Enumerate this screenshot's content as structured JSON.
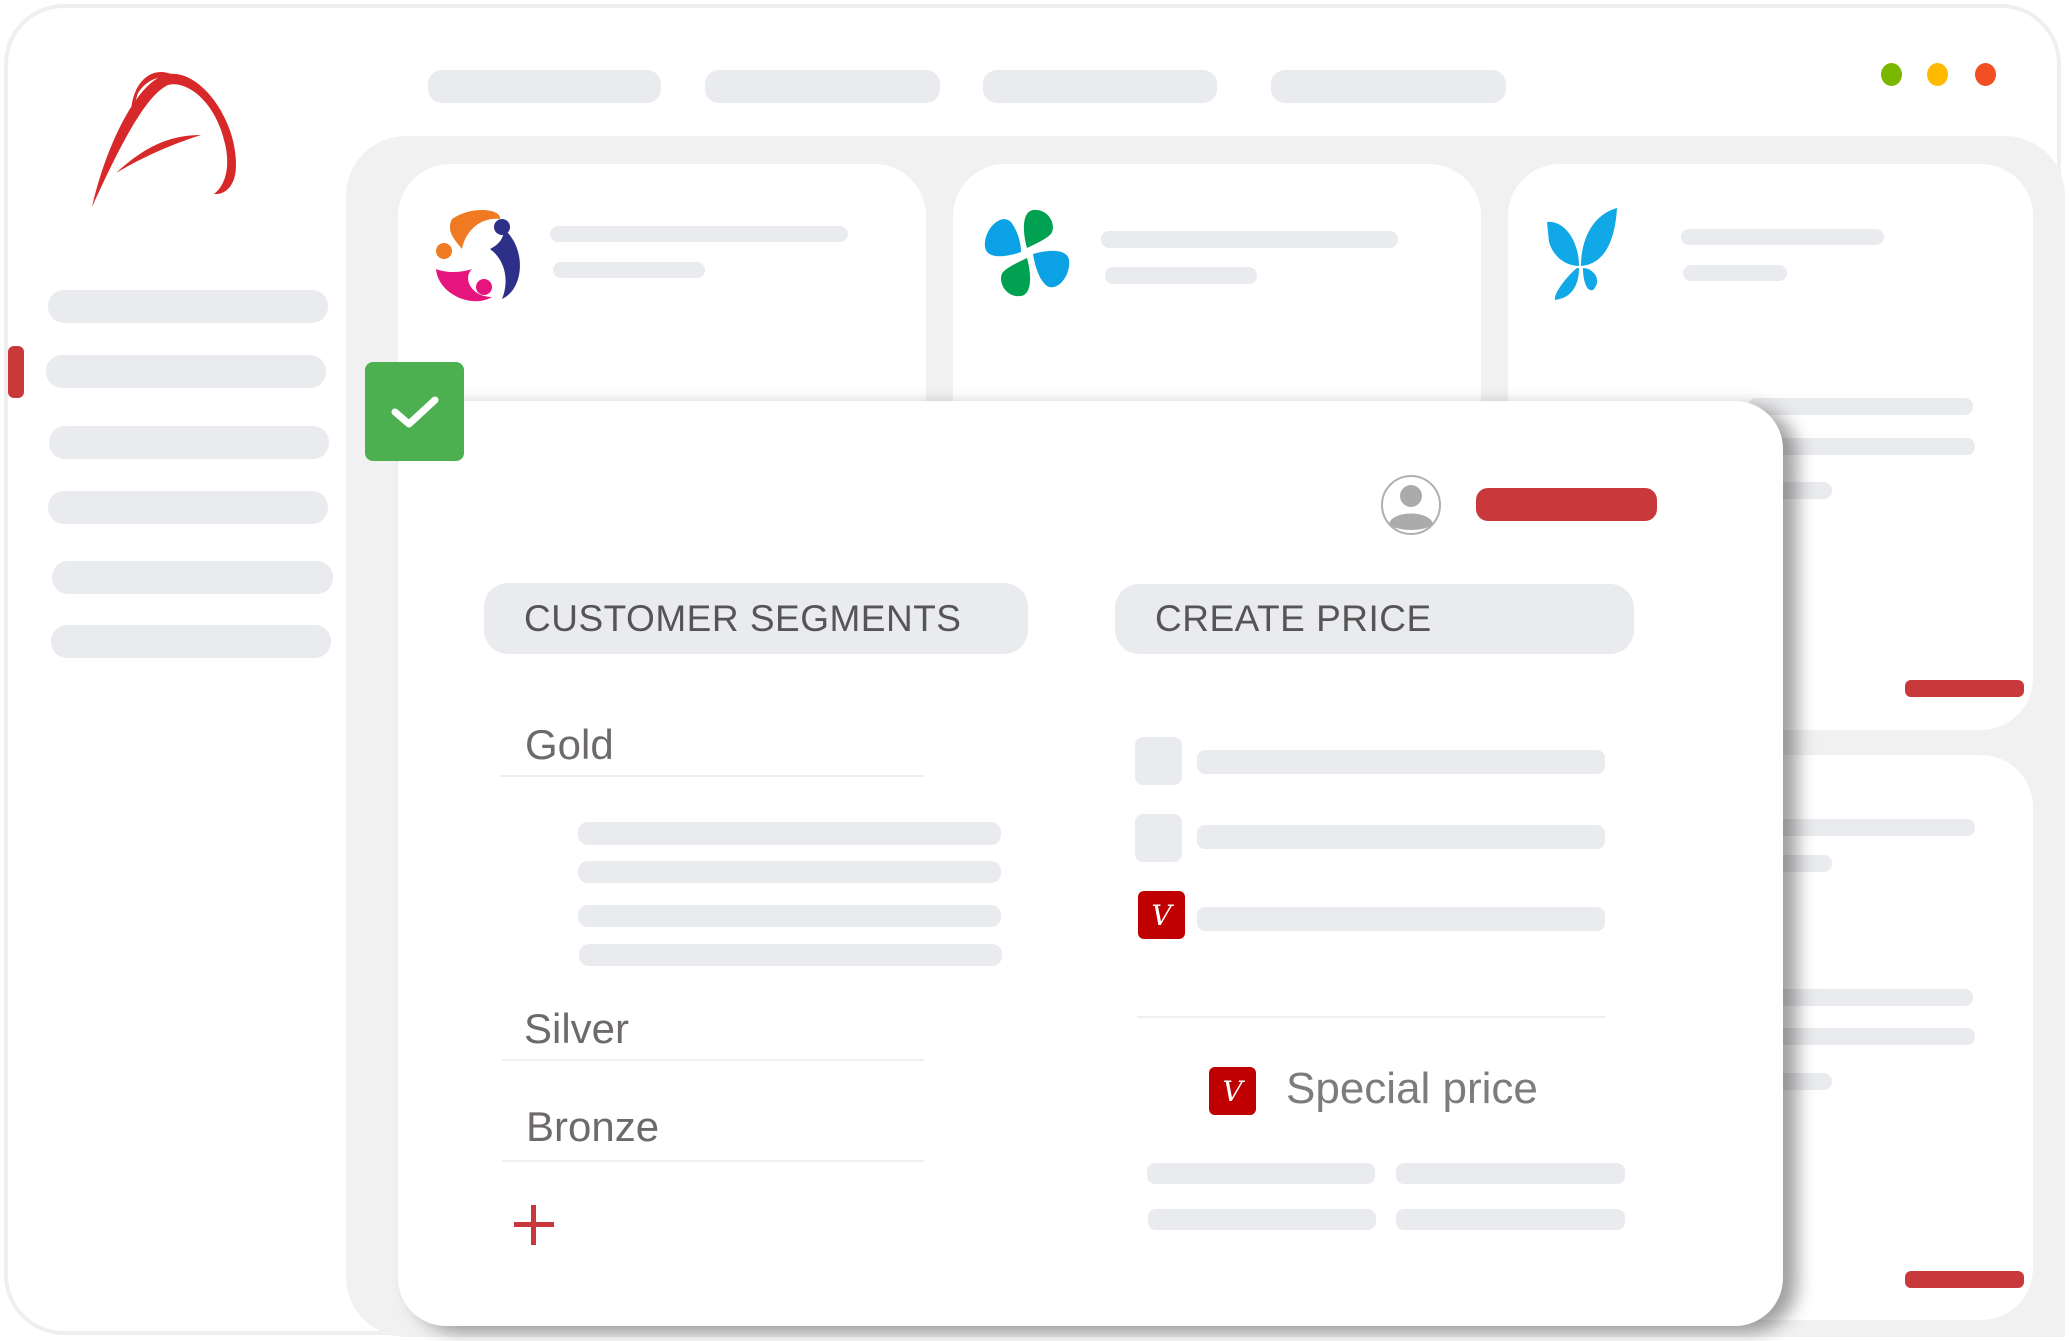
{
  "window": {
    "controls": [
      {
        "name": "green-dot",
        "color": "#7ab800"
      },
      {
        "name": "yellow-dot",
        "color": "#ffb900"
      },
      {
        "name": "red-dot",
        "color": "#f25022"
      }
    ]
  },
  "theme": {
    "accent": "#c9383a",
    "success": "#4caf50",
    "placeholder": "#eaebee",
    "badge": "#c00000"
  },
  "nav": {
    "active_tab_index": 0,
    "active_sidebar_index": 1
  },
  "modal": {
    "status_icon": "check-icon",
    "user_icon": "user-avatar-icon",
    "customer_segments": {
      "header": "CUSTOMER SEGMENTS",
      "items": [
        "Gold",
        "Silver",
        "Bronze"
      ],
      "add_icon": "+"
    },
    "create_price": {
      "header": "CREATE PRICE",
      "option_checked_index": 2,
      "badge_letter": "V",
      "special_price_label": "Special price"
    }
  }
}
